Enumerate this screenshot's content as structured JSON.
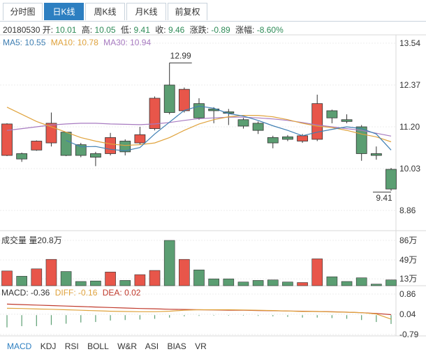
{
  "tabs": [
    {
      "label": "分时图",
      "active": false
    },
    {
      "label": "日K线",
      "active": true
    },
    {
      "label": "周K线",
      "active": false
    },
    {
      "label": "月K线",
      "active": false
    },
    {
      "label": "前复权",
      "active": false
    }
  ],
  "info": {
    "date": "20180530",
    "open_label": "开:",
    "open": "10.01",
    "high_label": "高:",
    "high": "10.05",
    "low_label": "低:",
    "low": "9.41",
    "close_label": "收:",
    "close": "9.46",
    "change_label": "涨跌:",
    "change": "-0.89",
    "pct_label": "涨幅:",
    "pct": "-8.60%"
  },
  "ma": {
    "ma5": "MA5: 10.55",
    "ma10": "MA10: 10.78",
    "ma30": "MA30: 10.94"
  },
  "volume": {
    "label": "成交量 量20.8万"
  },
  "macd": {
    "macd": "MACD: -0.36",
    "diff": "DIFF: -0.16",
    "dea": "DEA: 0.02"
  },
  "indicator_tabs": [
    {
      "label": "MACD",
      "active": true
    },
    {
      "label": "KDJ",
      "active": false
    },
    {
      "label": "RSI",
      "active": false
    },
    {
      "label": "BOLL",
      "active": false
    },
    {
      "label": "W&R",
      "active": false
    },
    {
      "label": "ASI",
      "active": false
    },
    {
      "label": "BIAS",
      "active": false
    },
    {
      "label": "VR",
      "active": false
    }
  ],
  "colors": {
    "up": "#e8564a",
    "down": "#5b9e72",
    "ma5": "#3f7fb3",
    "ma10": "#e0a33d",
    "ma30": "#a77ac0",
    "diff": "#e0a33d",
    "dea": "#c0392b",
    "accent": "#2d7fc1"
  },
  "chart_data": {
    "type": "candlestick",
    "price_axis": {
      "ticks": [
        "13.54",
        "12.37",
        "11.20",
        "10.03",
        "8.86"
      ],
      "range": [
        8.86,
        13.54
      ]
    },
    "volume_axis": {
      "ticks": [
        "86万",
        "49万",
        "13万"
      ]
    },
    "macd_axis": {
      "ticks": [
        "0.86",
        "0.04",
        "-0.79"
      ],
      "range": [
        -0.79,
        0.86
      ]
    },
    "annotations": {
      "high_label": "12.99",
      "low_label": "9.41"
    },
    "candles": [
      {
        "o": 10.4,
        "c": 11.28,
        "h": 11.3,
        "l": 10.38
      },
      {
        "o": 10.45,
        "c": 10.3,
        "h": 10.48,
        "l": 10.22
      },
      {
        "o": 10.55,
        "c": 10.8,
        "h": 10.82,
        "l": 10.53
      },
      {
        "o": 10.75,
        "c": 11.3,
        "h": 11.6,
        "l": 10.65
      },
      {
        "o": 11.05,
        "c": 10.4,
        "h": 11.06,
        "l": 10.38
      },
      {
        "o": 10.7,
        "c": 10.4,
        "h": 10.75,
        "l": 10.35
      },
      {
        "o": 10.45,
        "c": 10.35,
        "h": 10.5,
        "l": 10.1
      },
      {
        "o": 10.45,
        "c": 10.9,
        "h": 11.03,
        "l": 10.4
      },
      {
        "o": 10.8,
        "c": 10.5,
        "h": 10.85,
        "l": 10.4
      },
      {
        "o": 10.75,
        "c": 10.98,
        "h": 11.2,
        "l": 10.7
      },
      {
        "o": 11.15,
        "c": 12.0,
        "h": 12.05,
        "l": 11.1
      },
      {
        "o": 12.37,
        "c": 11.6,
        "h": 12.99,
        "l": 11.55
      },
      {
        "o": 11.65,
        "c": 12.25,
        "h": 12.3,
        "l": 11.6
      },
      {
        "o": 11.85,
        "c": 11.45,
        "h": 12.0,
        "l": 11.4
      },
      {
        "o": 11.7,
        "c": 11.65,
        "h": 11.75,
        "l": 11.3
      },
      {
        "o": 11.62,
        "c": 11.58,
        "h": 11.7,
        "l": 11.25
      },
      {
        "o": 11.4,
        "c": 11.22,
        "h": 11.45,
        "l": 11.15
      },
      {
        "o": 11.3,
        "c": 11.1,
        "h": 11.35,
        "l": 11.0
      },
      {
        "o": 10.9,
        "c": 10.75,
        "h": 10.95,
        "l": 10.6
      },
      {
        "o": 10.92,
        "c": 10.85,
        "h": 10.97,
        "l": 10.8
      },
      {
        "o": 10.8,
        "c": 10.95,
        "h": 11.0,
        "l": 10.75
      },
      {
        "o": 10.85,
        "c": 11.85,
        "h": 12.1,
        "l": 10.8
      },
      {
        "o": 11.65,
        "c": 11.45,
        "h": 11.68,
        "l": 11.3
      },
      {
        "o": 11.4,
        "c": 11.35,
        "h": 11.55,
        "l": 11.3
      },
      {
        "o": 11.2,
        "c": 10.45,
        "h": 11.25,
        "l": 10.25
      },
      {
        "o": 10.45,
        "c": 10.4,
        "h": 10.65,
        "l": 10.28
      },
      {
        "o": 10.01,
        "c": 9.46,
        "h": 10.05,
        "l": 9.41
      }
    ],
    "ma5": [
      null,
      null,
      null,
      null,
      10.82,
      10.64,
      10.65,
      10.57,
      10.53,
      10.62,
      11.0,
      11.33,
      11.66,
      11.78,
      11.72,
      11.57,
      11.5,
      11.38,
      11.23,
      11.1,
      10.95,
      11.05,
      11.13,
      11.2,
      11.15,
      11.0,
      10.55
    ],
    "ma10": [
      11.75,
      11.55,
      11.35,
      11.2,
      11.05,
      10.9,
      10.8,
      10.72,
      10.68,
      10.7,
      10.75,
      10.9,
      11.1,
      11.28,
      11.4,
      11.48,
      11.52,
      11.52,
      11.48,
      11.4,
      11.3,
      11.22,
      11.18,
      11.1,
      11.0,
      10.92,
      10.78
    ],
    "ma30": [
      11.1,
      11.15,
      11.2,
      11.25,
      11.28,
      11.3,
      11.3,
      11.28,
      11.27,
      11.26,
      11.28,
      11.32,
      11.38,
      11.43,
      11.45,
      11.47,
      11.47,
      11.45,
      11.42,
      11.38,
      11.32,
      11.25,
      11.2,
      11.15,
      11.1,
      11.02,
      10.94
    ],
    "volumes": [
      28,
      18,
      32,
      50,
      27,
      8,
      9,
      26,
      10,
      21,
      29,
      86,
      50,
      30,
      13,
      13,
      7,
      10,
      11,
      7,
      6,
      51,
      17,
      8,
      15,
      3,
      11
    ],
    "macd_hist": [
      -0.5,
      -0.45,
      -0.45,
      -0.4,
      -0.35,
      -0.3,
      -0.28,
      -0.22,
      -0.2,
      -0.18,
      -0.15,
      -0.1,
      -0.05,
      -0.03,
      -0.02,
      -0.02,
      -0.02,
      -0.03,
      -0.05,
      -0.07,
      -0.1,
      -0.1,
      -0.12,
      -0.15,
      -0.2,
      -0.28,
      -0.36
    ],
    "macd_diff": [
      0.28,
      0.27,
      0.25,
      0.24,
      0.22,
      0.2,
      0.18,
      0.16,
      0.15,
      0.14,
      0.14,
      0.16,
      0.2,
      0.22,
      0.22,
      0.22,
      0.21,
      0.2,
      0.19,
      0.17,
      0.15,
      0.15,
      0.13,
      0.12,
      0.1,
      0.05,
      -0.16
    ],
    "macd_dea": [
      0.45,
      0.43,
      0.41,
      0.39,
      0.37,
      0.35,
      0.33,
      0.31,
      0.29,
      0.27,
      0.26,
      0.24,
      0.23,
      0.22,
      0.21,
      0.2,
      0.2,
      0.19,
      0.18,
      0.17,
      0.16,
      0.15,
      0.14,
      0.12,
      0.1,
      0.07,
      0.02
    ]
  }
}
